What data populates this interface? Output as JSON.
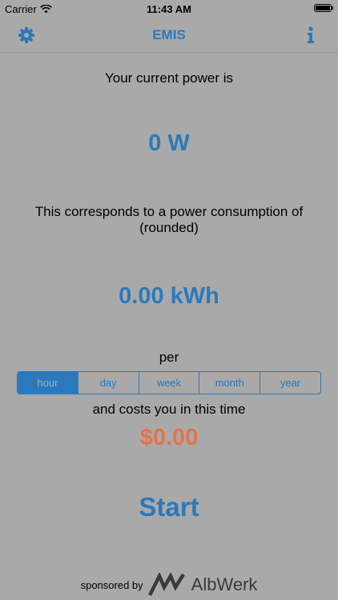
{
  "status_bar": {
    "carrier": "Carrier",
    "time": "11:43 AM"
  },
  "nav": {
    "title": "EMIS",
    "left_icon": "gear-icon",
    "right_icon": "info-icon"
  },
  "main": {
    "power_label": "Your current power is",
    "power_value": "0 W",
    "consumption_label_line1": "This corresponds to a power consumption of",
    "consumption_label_line2": "(rounded)",
    "consumption_value": "0.00 kWh",
    "per_label": "per",
    "periods": [
      "hour",
      "day",
      "week",
      "month",
      "year"
    ],
    "selected_period": "hour",
    "cost_label": "and costs you in this time",
    "cost_value": "$0.00",
    "start_label": "Start"
  },
  "footer": {
    "sponsored_label": "sponsored by",
    "sponsor_name": "AlbWerk"
  },
  "colors": {
    "background": "#a9a9a9",
    "accent": "#2b79bd",
    "cost": "#e5734a"
  }
}
